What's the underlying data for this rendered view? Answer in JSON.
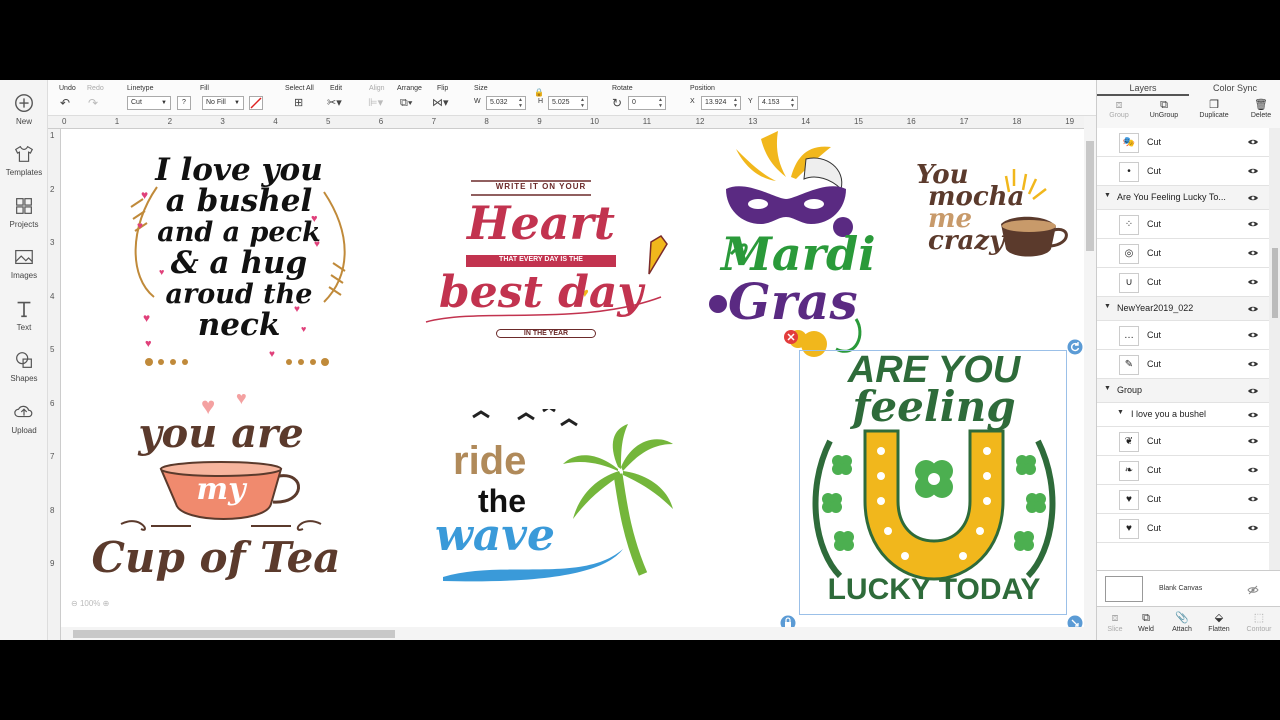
{
  "left_toolbar": [
    {
      "label": "New",
      "icon": "plus-circle-icon"
    },
    {
      "label": "Templates",
      "icon": "shirt-icon"
    },
    {
      "label": "Projects",
      "icon": "grid-icon"
    },
    {
      "label": "Images",
      "icon": "image-icon"
    },
    {
      "label": "Text",
      "icon": "text-icon"
    },
    {
      "label": "Shapes",
      "icon": "shapes-icon"
    },
    {
      "label": "Upload",
      "icon": "upload-icon"
    }
  ],
  "toolbar": {
    "undo": "Undo",
    "redo": "Redo",
    "linetype_label": "Linetype",
    "linetype_value": "Cut",
    "help": "?",
    "fill_label": "Fill",
    "fill_value": "No Fill",
    "select_all": "Select All",
    "edit": "Edit",
    "align": "Align",
    "arrange": "Arrange",
    "flip": "Flip",
    "size_label": "Size",
    "w_label": "W",
    "w_value": "5.032",
    "h_label": "H",
    "h_value": "5.025",
    "rotate_label": "Rotate",
    "rotate_value": "0",
    "position_label": "Position",
    "x_label": "X",
    "x_value": "13.924",
    "y_label": "Y",
    "y_value": "4.153"
  },
  "ruler": {
    "top": [
      "0",
      "1",
      "2",
      "3",
      "4",
      "5",
      "6",
      "7",
      "8",
      "9",
      "10",
      "11",
      "12",
      "13",
      "14",
      "15",
      "16",
      "17",
      "18",
      "19"
    ],
    "left": [
      "1",
      "2",
      "3",
      "4",
      "5",
      "6",
      "7",
      "8",
      "9"
    ]
  },
  "canvas": {
    "zoom": "100%",
    "designs": {
      "bushel": [
        "I love you",
        "a bushel",
        "and a peck",
        "& a hug",
        "aroud the",
        "neck"
      ],
      "heart": {
        "top": "WRITE IT ON YOUR",
        "main": "Heart",
        "band": "THAT EVERY DAY IS THE",
        "best": "best day",
        "bottom": "IN THE YEAR"
      },
      "mardi": [
        "Mardi",
        "Gras"
      ],
      "mocha": [
        "You",
        "mocha",
        "me",
        "crazy"
      ],
      "tea": [
        "you are",
        "my",
        "Cup of Tea"
      ],
      "wave": [
        "ride",
        "the",
        "wave"
      ],
      "lucky": {
        "top1": "ARE YOU",
        "top2": "feeling",
        "bottom": "LUCKY TODAY"
      }
    }
  },
  "panel": {
    "tabs": [
      "Layers",
      "Color Sync"
    ],
    "top_buttons": [
      "Group",
      "UnGroup",
      "Duplicate",
      "Delete"
    ],
    "layers": [
      {
        "type": "item",
        "name": "Cut",
        "thumb": "🎭"
      },
      {
        "type": "item",
        "name": "Cut",
        "thumb": "•"
      },
      {
        "type": "group",
        "name": "Are You Feeling Lucky To..."
      },
      {
        "type": "item",
        "name": "Cut",
        "thumb": "⁘"
      },
      {
        "type": "item",
        "name": "Cut",
        "thumb": "◎"
      },
      {
        "type": "item",
        "name": "Cut",
        "thumb": "∪"
      },
      {
        "type": "group",
        "name": "NewYear2019_022"
      },
      {
        "type": "item",
        "name": "Cut",
        "thumb": "…"
      },
      {
        "type": "item",
        "name": "Cut",
        "thumb": "✎"
      },
      {
        "type": "group",
        "name": "Group"
      },
      {
        "type": "subgroup",
        "name": "I love you a bushel"
      },
      {
        "type": "item",
        "name": "Cut",
        "thumb": "❦"
      },
      {
        "type": "item",
        "name": "Cut",
        "thumb": "❧"
      },
      {
        "type": "item",
        "name": "Cut",
        "thumb": "♥"
      },
      {
        "type": "item",
        "name": "Cut",
        "thumb": "♥"
      }
    ],
    "blank_canvas": "Blank Canvas",
    "bottom_buttons": [
      "Slice",
      "Weld",
      "Attach",
      "Flatten",
      "Contour"
    ]
  },
  "colors": {
    "lucky_green": "#2e6b3a",
    "lucky_gold": "#f1b71c",
    "mardi_purple": "#5a2a82",
    "mardi_green": "#2a9a3a",
    "heart_red": "#c2334f",
    "tea_brown": "#5b3a2c",
    "tea_coral": "#f08a6e",
    "wave_blue": "#3a9ad9",
    "palm_green": "#74b63b"
  }
}
